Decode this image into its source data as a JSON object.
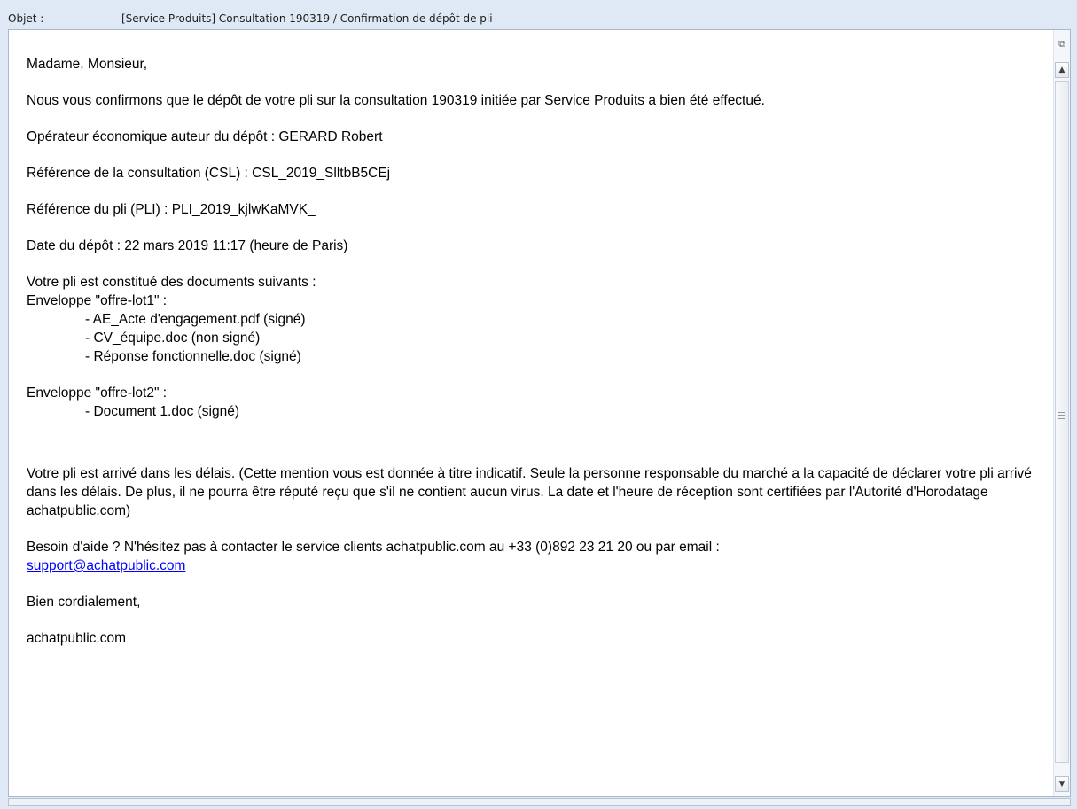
{
  "header": {
    "subject_label": "Objet :",
    "subject_value": "[Service Produits] Consultation 190319 / Confirmation de dépôt de pli"
  },
  "email": {
    "greeting": "Madame, Monsieur,",
    "confirmation": "Nous vous confirmons que le dépôt de votre pli sur la consultation 190319 initiée par Service Produits a bien été effectué.",
    "operator": "Opérateur économique auteur du dépôt : GERARD Robert",
    "consultation_ref": "Référence de la consultation (CSL) : CSL_2019_SlltbB5CEj",
    "pli_ref": "Référence du pli (PLI) : PLI_2019_kjlwKaMVK_",
    "deposit_date": "Date du dépôt : 22 mars 2019 11:17 (heure de Paris)",
    "documents_intro": "Votre pli est constitué des documents suivants :",
    "envelope1": {
      "label": "Enveloppe \"offre-lot1\" :",
      "files": [
        "- AE_Acte d'engagement.pdf (signé)",
        "- CV_équipe.doc (non signé)",
        "- Réponse fonctionnelle.doc (signé)"
      ]
    },
    "envelope2": {
      "label": "Enveloppe \"offre-lot2\" :",
      "files": [
        "- Document 1.doc (signé)"
      ]
    },
    "arrival_notice": "Votre pli est arrivé dans les délais. (Cette mention vous est donnée à titre indicatif. Seule la personne responsable du marché a la capacité de déclarer votre pli arrivé dans les délais. De plus, il ne pourra être réputé reçu que s'il ne contient aucun virus. La date et l'heure de réception sont certifiées par l'Autorité d'Horodatage achatpublic.com)",
    "help_text": "Besoin d'aide ? N'hésitez pas à contacter le service clients achatpublic.com au +33 (0)892 23 21 20 ou par email :",
    "support_email": "support@achatpublic.com",
    "closing": "Bien cordialement,",
    "signature": "achatpublic.com"
  },
  "scrollbar": {
    "top_icon": "message-format-icon",
    "up_icon": "arrow-up-icon",
    "down_icon": "arrow-down-icon"
  }
}
